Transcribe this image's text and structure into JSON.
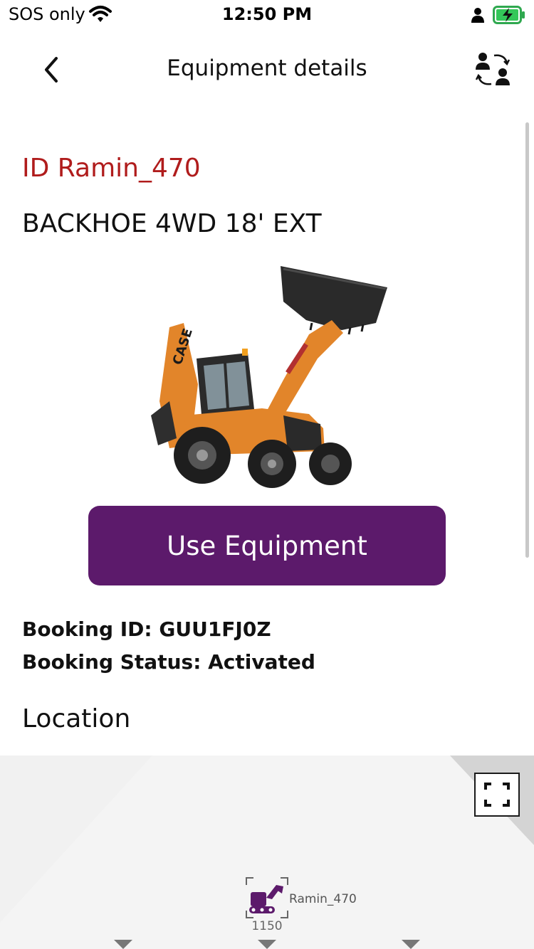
{
  "status_bar": {
    "carrier": "SOS only",
    "time": "12:50 PM"
  },
  "nav": {
    "title": "Equipment details",
    "back_icon": "chevron-left-icon",
    "action_icon": "switch-user-icon"
  },
  "equipment": {
    "id_label": "ID Ramin_470",
    "name": "BACKHOE 4WD 18' EXT",
    "image": "backhoe-loader-photo",
    "brand_mark": "CASE"
  },
  "actions": {
    "use_label": "Use Equipment"
  },
  "booking": {
    "id_line": "Booking ID: GUU1FJ0Z",
    "status_line": "Booking Status: Activated"
  },
  "location": {
    "heading": "Location",
    "marker_label": "Ramin_470",
    "marker_sub": "1150"
  },
  "colors": {
    "accent": "#5c1a6b",
    "id_red": "#b01c1c",
    "battery_green": "#34c759"
  }
}
